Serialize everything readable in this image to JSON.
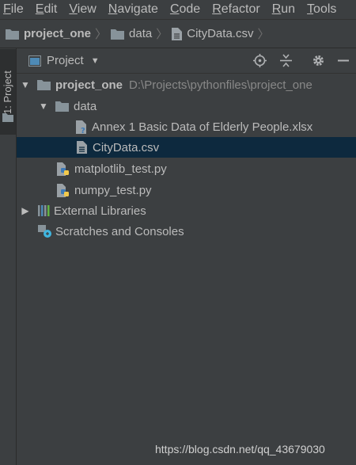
{
  "menubar": {
    "items": [
      {
        "label": "File",
        "underline": "F",
        "rest": "ile"
      },
      {
        "label": "Edit",
        "underline": "E",
        "rest": "dit"
      },
      {
        "label": "View",
        "underline": "V",
        "rest": "iew"
      },
      {
        "label": "Navigate",
        "underline": "N",
        "rest": "avigate"
      },
      {
        "label": "Code",
        "underline": "C",
        "rest": "ode"
      },
      {
        "label": "Refactor",
        "underline": "R",
        "rest": "efactor"
      },
      {
        "label": "Run",
        "underline": "R",
        "rest": "un"
      },
      {
        "label": "Tools",
        "underline": "T",
        "rest": "ools"
      }
    ]
  },
  "breadcrumb": {
    "project": "project_one",
    "folder": "data",
    "file": "CityData.csv"
  },
  "sidebar": {
    "tab_label": "1: Project"
  },
  "panel": {
    "view_label": "Project"
  },
  "tree": {
    "root_name": "project_one",
    "root_path": "D:\\Projects\\pythonfiles\\project_one",
    "data_folder": "data",
    "file_xlsx": "Annex 1 Basic Data of Elderly People.xlsx",
    "file_csv": "CityData.csv",
    "file_matplotlib": "matplotlib_test.py",
    "file_numpy": "numpy_test.py",
    "external_libraries": "External Libraries",
    "scratches": "Scratches and Consoles"
  },
  "watermark": "https://blog.csdn.net/qq_43679030",
  "colors": {
    "background": "#3c3f41",
    "selection": "#0d293e",
    "text": "#bbbbbb",
    "folder": "#87939a",
    "python_blue": "#3d7ab8",
    "python_yellow": "#f2c94c"
  }
}
